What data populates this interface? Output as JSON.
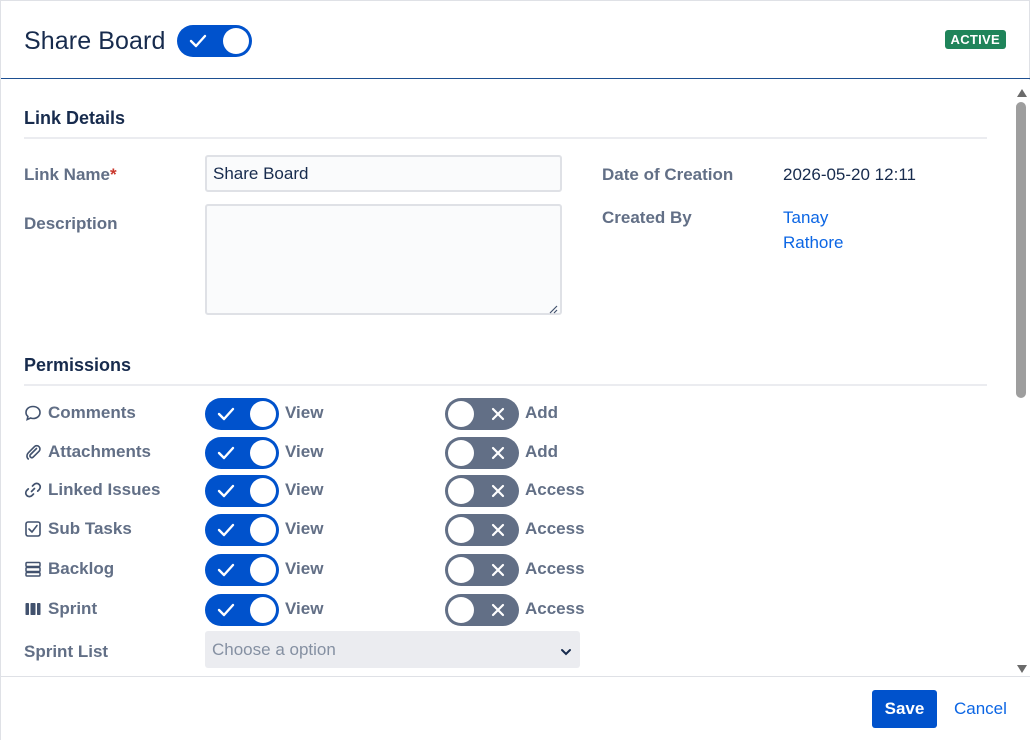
{
  "header": {
    "title": "Share Board",
    "active_toggle_on": true,
    "status": "ACTIVE"
  },
  "link_details": {
    "section_title": "Link Details",
    "link_name_label": "Link Name",
    "required_marker": "*",
    "link_name_value": "Share Board",
    "description_label": "Description",
    "description_value": "",
    "date_label": "Date of Creation",
    "date_value": "2026-05-20 12:11",
    "created_by_label": "Created By",
    "created_by_value": "Tanay Rathore"
  },
  "permissions": {
    "section_title": "Permissions",
    "rows": [
      {
        "label": "Comments",
        "icon": "comment-icon",
        "view_label": "View",
        "view_on": true,
        "edit_label": "Add",
        "edit_on": false
      },
      {
        "label": "Attachments",
        "icon": "paperclip-icon",
        "view_label": "View",
        "view_on": true,
        "edit_label": "Add",
        "edit_on": false
      },
      {
        "label": "Linked Issues",
        "icon": "link-icon",
        "view_label": "View",
        "view_on": true,
        "edit_label": "Access",
        "edit_on": false
      },
      {
        "label": "Sub Tasks",
        "icon": "subtask-icon",
        "view_label": "View",
        "view_on": true,
        "edit_label": "Access",
        "edit_on": false
      },
      {
        "label": "Backlog",
        "icon": "backlog-icon",
        "view_label": "View",
        "view_on": true,
        "edit_label": "Access",
        "edit_on": false
      },
      {
        "label": "Sprint",
        "icon": "sprint-icon",
        "view_label": "View",
        "view_on": true,
        "edit_label": "Access",
        "edit_on": false
      }
    ],
    "sprint_list_label": "Sprint List",
    "sprint_list_placeholder": "Choose a option"
  },
  "footer": {
    "save_label": "Save",
    "cancel_label": "Cancel"
  },
  "colors": {
    "primary": "#0052cc",
    "toggle_off": "#626f86",
    "status_green": "#1f845a",
    "link": "#0c66e4"
  }
}
